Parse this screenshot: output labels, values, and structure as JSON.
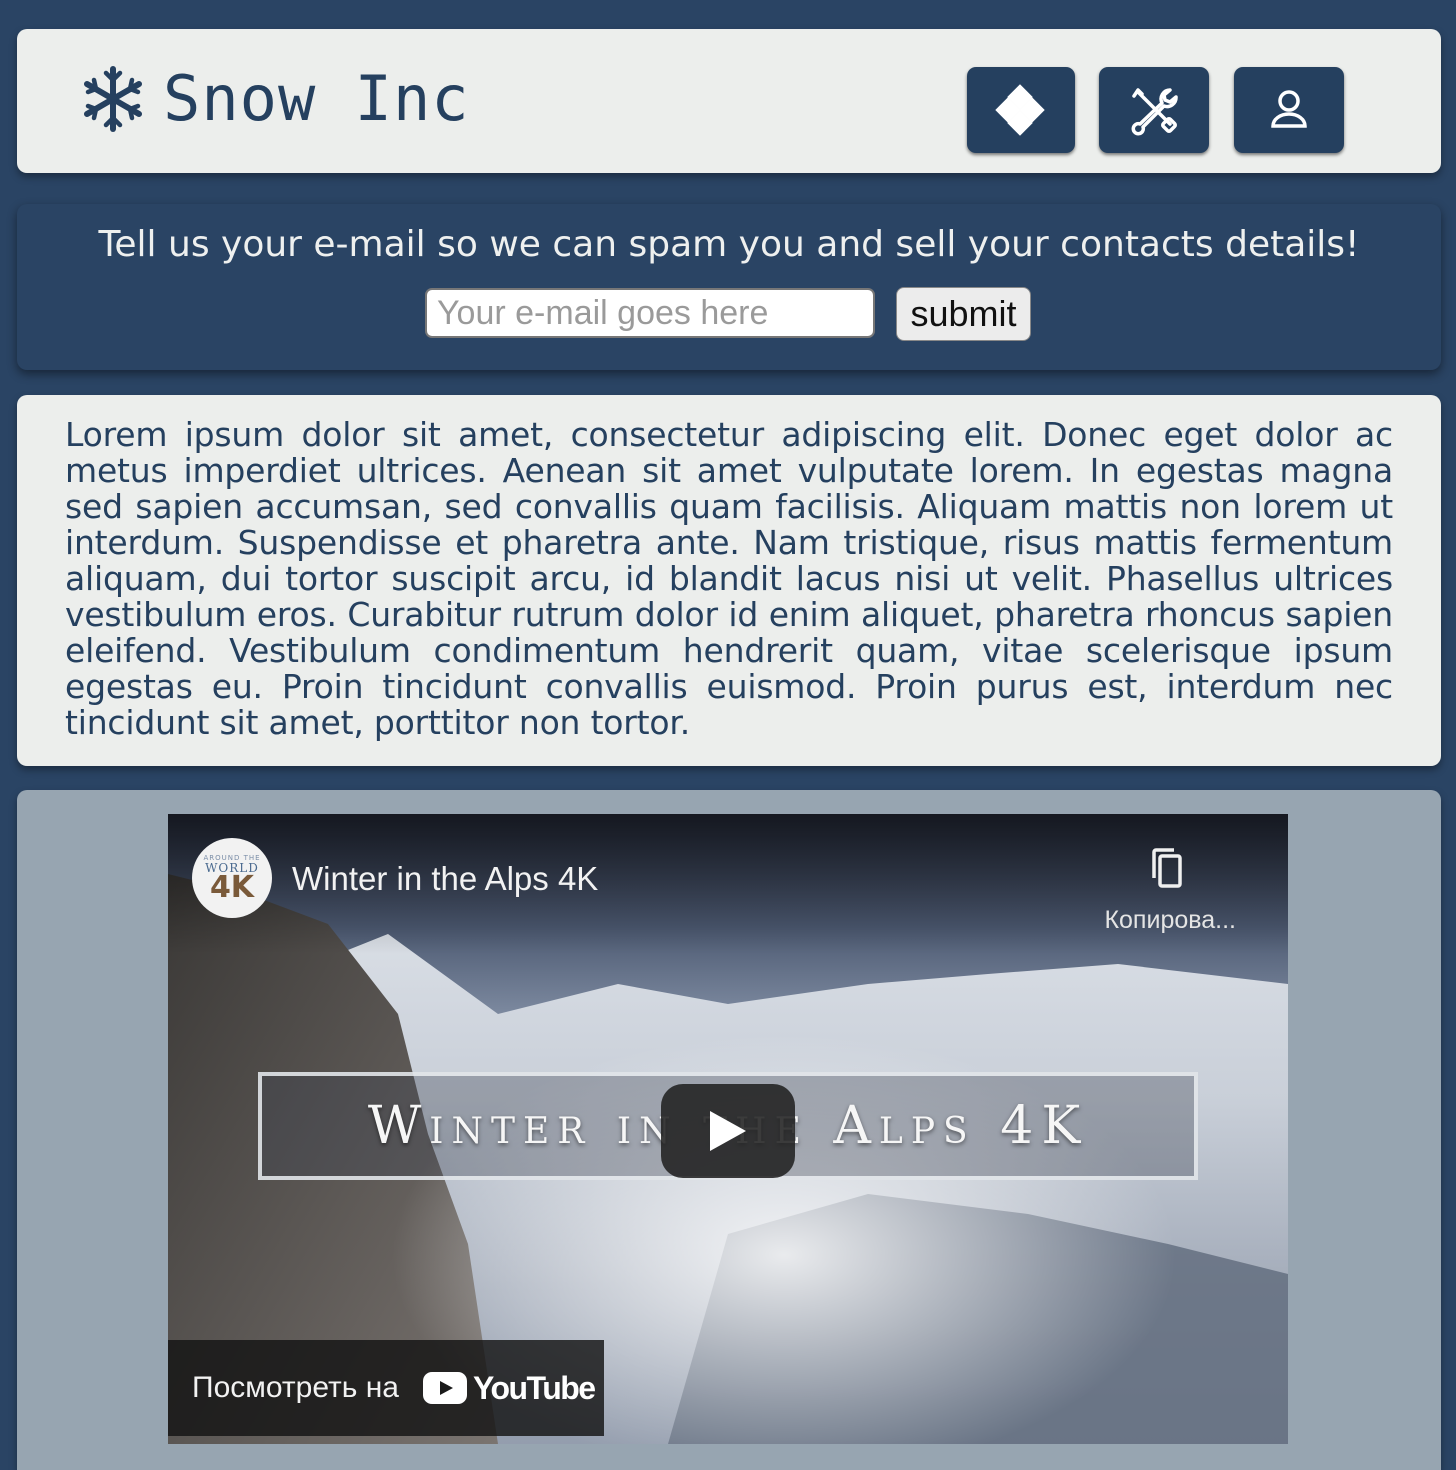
{
  "header": {
    "brand": "Snow Inc",
    "logo_icon": "snowflake-icon",
    "nav": [
      {
        "name": "diamond-icon"
      },
      {
        "name": "tools-icon"
      },
      {
        "name": "user-icon"
      }
    ]
  },
  "newsletter": {
    "text": "Tell us your e-mail so we can spam you and sell your contacts details!",
    "placeholder": "Your e-mail goes here",
    "submit_label": "submit"
  },
  "content": {
    "paragraph": "Lorem ipsum dolor sit amet, consectetur adipiscing elit. Donec eget dolor ac metus imperdiet ultrices. Aenean sit amet vulputate lorem. In egestas magna sed sapien accumsan, sed convallis quam facilisis. Aliquam mattis non lorem ut interdum. Suspendisse et pharetra ante. Nam tristique, risus mattis fermentum aliquam, dui tortor suscipit arcu, id blandit lacus nisi ut velit. Phasellus ultrices vestibulum eros. Curabitur rutrum dolor id enim aliquet, pharetra rhoncus sapien eleifend. Vestibulum condimentum hendrerit quam, vitae scelerisque ipsum egestas eu. Proin tincidunt convallis euismod. Proin purus est, interdum nec tincidunt sit amet, porttitor non tortor."
  },
  "video": {
    "title": "Winter in the Alps 4K",
    "channel_small": "AROUND THE",
    "channel_world": "WORLD",
    "channel_4k": "4K",
    "copy_label": "Копирова...",
    "overlay_title": "Winter in the Alps 4K",
    "watch_on": "Посмотреть на",
    "youtube_word": "YouTube"
  },
  "colors": {
    "navy": "#25405f",
    "page_bg": "#2a4464",
    "card_light": "#eceeec",
    "video_card_bg": "#97a5b1"
  }
}
